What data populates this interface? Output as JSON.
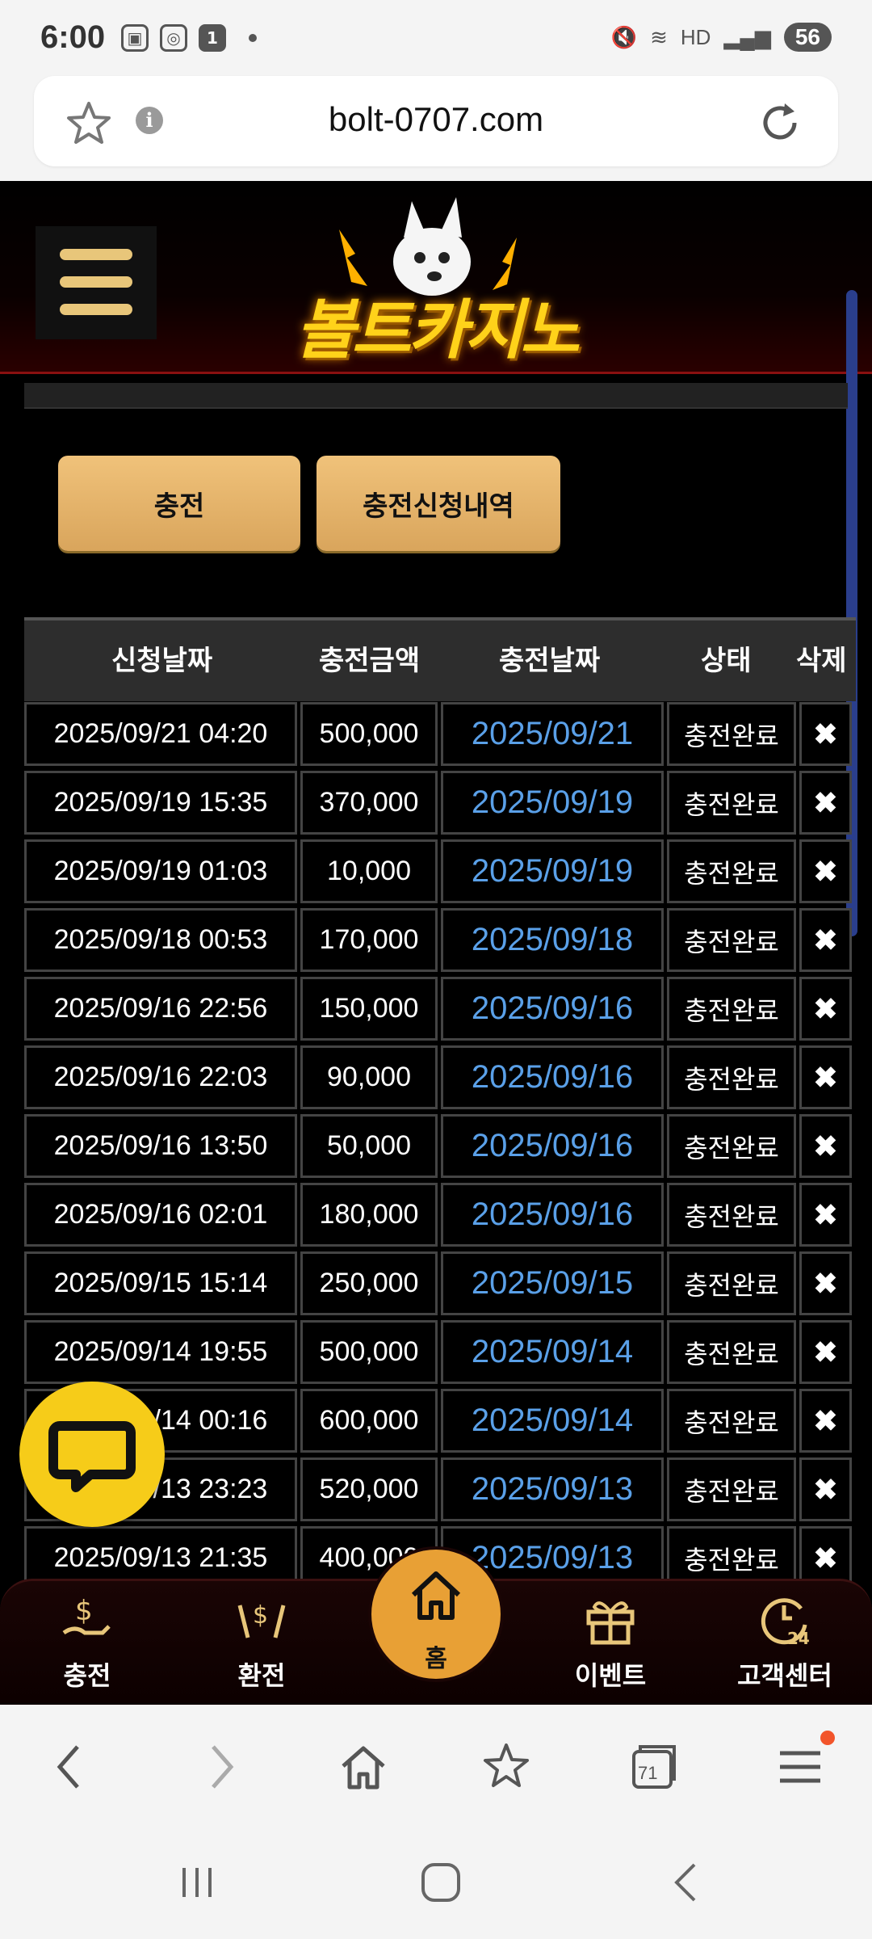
{
  "status_bar": {
    "time": "6:00",
    "notif_badge": "1",
    "battery": "56",
    "hd": "HD"
  },
  "browser": {
    "url": "bolt-0707.com"
  },
  "site": {
    "logo_text": "볼트카지노"
  },
  "actions": {
    "charge_label": "충전",
    "history_label": "충전신청내역"
  },
  "table": {
    "headers": [
      "신청날짜",
      "충전금액",
      "충전날짜",
      "상태",
      "삭제"
    ],
    "rows": [
      {
        "requested": "2025/09/21 04:20",
        "amount": "500,000",
        "charged": "2025/09/21",
        "status": "충전완료",
        "delete": "✖"
      },
      {
        "requested": "2025/09/19 15:35",
        "amount": "370,000",
        "charged": "2025/09/19",
        "status": "충전완료",
        "delete": "✖"
      },
      {
        "requested": "2025/09/19 01:03",
        "amount": "10,000",
        "charged": "2025/09/19",
        "status": "충전완료",
        "delete": "✖"
      },
      {
        "requested": "2025/09/18 00:53",
        "amount": "170,000",
        "charged": "2025/09/18",
        "status": "충전완료",
        "delete": "✖"
      },
      {
        "requested": "2025/09/16 22:56",
        "amount": "150,000",
        "charged": "2025/09/16",
        "status": "충전완료",
        "delete": "✖"
      },
      {
        "requested": "2025/09/16 22:03",
        "amount": "90,000",
        "charged": "2025/09/16",
        "status": "충전완료",
        "delete": "✖"
      },
      {
        "requested": "2025/09/16 13:50",
        "amount": "50,000",
        "charged": "2025/09/16",
        "status": "충전완료",
        "delete": "✖"
      },
      {
        "requested": "2025/09/16 02:01",
        "amount": "180,000",
        "charged": "2025/09/16",
        "status": "충전완료",
        "delete": "✖"
      },
      {
        "requested": "2025/09/15 15:14",
        "amount": "250,000",
        "charged": "2025/09/15",
        "status": "충전완료",
        "delete": "✖"
      },
      {
        "requested": "2025/09/14 19:55",
        "amount": "500,000",
        "charged": "2025/09/14",
        "status": "충전완료",
        "delete": "✖"
      },
      {
        "requested": "2025/09/14 00:16",
        "amount": "600,000",
        "charged": "2025/09/14",
        "status": "충전완료",
        "delete": "✖"
      },
      {
        "requested": "2025/09/13 23:23",
        "amount": "520,000",
        "charged": "2025/09/13",
        "status": "충전완료",
        "delete": "✖"
      },
      {
        "requested": "2025/09/13 21:35",
        "amount": "400,000",
        "charged": "2025/09/13",
        "status": "충전완료",
        "delete": "✖"
      }
    ]
  },
  "bottom_nav": {
    "charge": "충전",
    "exchange": "환전",
    "home": "홈",
    "event": "이벤트",
    "support": "고객센터"
  },
  "browser_tabs": {
    "count": "71"
  },
  "colors": {
    "gold": "#e8c67a",
    "link_blue": "#5aa0e8",
    "chat_yellow": "#f6cc19"
  }
}
